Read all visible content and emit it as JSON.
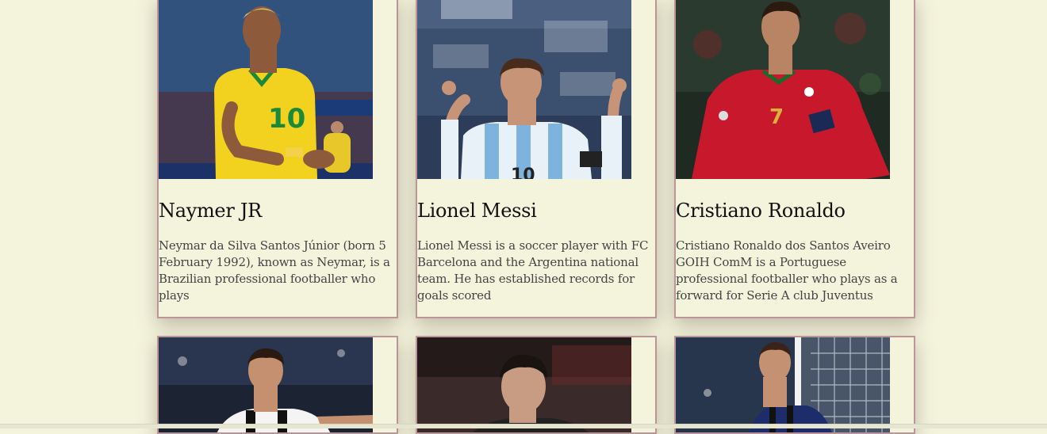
{
  "players": [
    {
      "name": "Naymer JR",
      "bio": "Neymar da Silva Santos Júnior (born 5 February 1992), known as Neymar, is a Brazilian professional footballer who plays",
      "photo_icon": "player-photo-neymar",
      "colors": {
        "bg": "#2c4a73",
        "kit": "#f2d21e",
        "skin": "#8d5a3b",
        "accent": "#1a8a3a"
      }
    },
    {
      "name": "Lionel Messi",
      "bio": "Lionel Messi is a soccer player with FC Barcelona and the Argentina national team. He has established records for goals scored",
      "photo_icon": "player-photo-messi",
      "colors": {
        "bg": "#3b4f6e",
        "kit": "#e9f1f8",
        "skin": "#c79478",
        "accent": "#7db3dd"
      }
    },
    {
      "name": "Cristiano Ronaldo",
      "bio": "Cristiano Ronaldo dos Santos Aveiro GOIH ComM is a Portuguese professional footballer who plays as a forward for Serie A club Juventus",
      "photo_icon": "player-photo-ronaldo",
      "colors": {
        "bg": "#1e2a22",
        "kit": "#c8182b",
        "skin": "#b98463",
        "accent": "#d8b23a"
      }
    }
  ],
  "partial_players": [
    {
      "photo_icon": "player-photo-dybala",
      "colors": {
        "bg": "#1c2433",
        "kit": "#f4f4f4",
        "skin": "#c4906f"
      }
    },
    {
      "photo_icon": "player-photo-ozil",
      "colors": {
        "bg": "#3a2a2a",
        "kit": "#222",
        "skin": "#c89c82"
      }
    },
    {
      "photo_icon": "player-photo-icardi",
      "colors": {
        "bg": "#27354d",
        "kit": "#1d2c6b",
        "skin": "#c49273"
      }
    }
  ]
}
